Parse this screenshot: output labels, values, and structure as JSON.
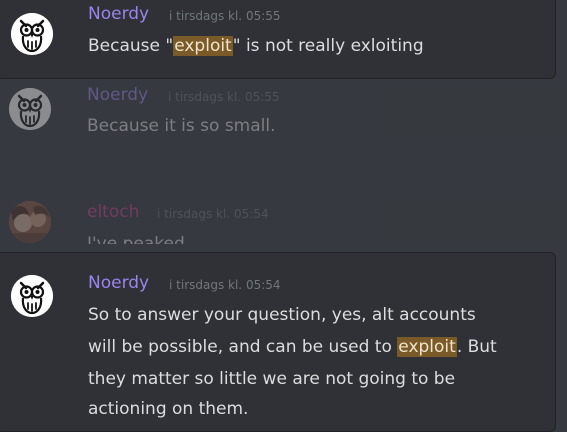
{
  "results": [
    {
      "author": "Noerdy",
      "timestamp": "i tirsdags kl. 05:55",
      "text_before": "Because \"",
      "highlight": "exploit",
      "text_after": "\" is not really exloiting",
      "avatar_icon": "owl-icon"
    },
    {
      "author": "Noerdy",
      "timestamp": "i tirsdags kl. 05:55",
      "text": "Because it is so small.",
      "avatar_icon": "owl-icon",
      "context": true
    },
    {
      "author": "eltoch",
      "timestamp": "i tirsdags kl. 05:54",
      "text": "I've peaked",
      "avatar_icon": "user-photo",
      "context": true
    },
    {
      "author": "Noerdy",
      "timestamp": "i tirsdags kl. 05:54",
      "line1": "So to answer your question, yes, alt accounts",
      "line2_before": "will be possible, and can be used to ",
      "line2_highlight": "exploit",
      "line2_after": ". But",
      "line3": "they matter so little we are not going to be",
      "line4": "actioning on them.",
      "avatar_icon": "owl-icon"
    }
  ],
  "colors": {
    "background": "#36393f",
    "card": "#2f3136",
    "noerdy_name": "#9b84ec",
    "eltoch_name": "#c43f8e",
    "highlight": "#7a5a26",
    "timestamp": "#72767d",
    "message": "#dcddde"
  }
}
